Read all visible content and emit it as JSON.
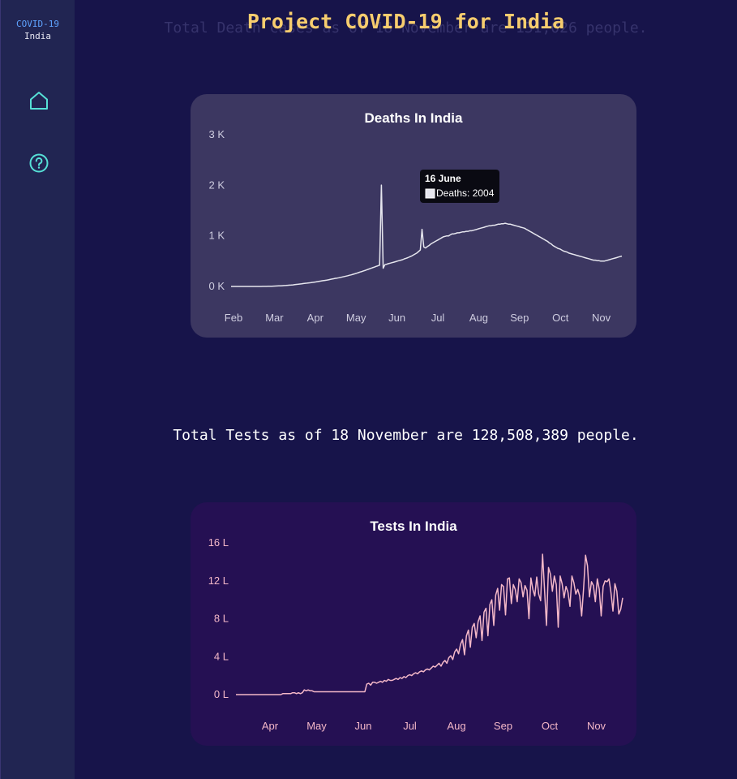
{
  "sidebar": {
    "brand_line1": "COVID-19",
    "brand_line2": "India",
    "items": [
      {
        "icon": "home-icon"
      },
      {
        "icon": "help-icon"
      }
    ],
    "icon_color": "#56e0d6"
  },
  "header": {
    "title": "Project COVID-19 for India",
    "background_text": "Total Death cases as of 18 November are 131,026 people."
  },
  "tests_summary": "Total Tests as of 18 November are 128,508,389 people.",
  "chart_data": [
    {
      "type": "line",
      "title": "Deaths In India",
      "x_tick_labels": [
        "Feb",
        "Mar",
        "Apr",
        "May",
        "Jun",
        "Jul",
        "Aug",
        "Sep",
        "Oct",
        "Nov"
      ],
      "y_tick_labels": [
        "0 K",
        "1 K",
        "2 K",
        "3 K"
      ],
      "ylim": [
        0,
        3000
      ],
      "series": [
        {
          "name": "Deaths",
          "color": "#e6e6ee",
          "values": [
            0,
            0,
            0,
            0,
            0,
            0,
            0,
            0,
            0,
            0,
            0,
            0,
            0,
            0,
            0,
            0,
            0,
            0,
            1,
            2,
            2,
            3,
            4,
            5,
            6,
            8,
            9,
            11,
            12,
            14,
            17,
            19,
            22,
            25,
            28,
            30,
            36,
            40,
            44,
            48,
            52,
            58,
            62,
            66,
            70,
            74,
            80,
            85,
            90,
            96,
            102,
            108,
            114,
            118,
            124,
            130,
            138,
            146,
            152,
            160,
            166,
            172,
            180,
            188,
            195,
            204,
            212,
            222,
            230,
            240,
            250,
            262,
            272,
            285,
            295,
            308,
            320,
            332,
            345,
            358,
            370,
            382,
            396,
            408,
            420,
            2004,
            360,
            430,
            440,
            450,
            460,
            470,
            480,
            490,
            500,
            510,
            520,
            530,
            545,
            556,
            570,
            585,
            600,
            620,
            640,
            660,
            690,
            720,
            1130,
            780,
            760,
            790,
            810,
            840,
            860,
            880,
            900,
            920,
            940,
            960,
            980,
            990,
            1000,
            1000,
            1020,
            1040,
            1040,
            1050,
            1060,
            1060,
            1070,
            1080,
            1080,
            1090,
            1090,
            1100,
            1100,
            1110,
            1120,
            1130,
            1140,
            1150,
            1160,
            1170,
            1180,
            1190,
            1200,
            1200,
            1210,
            1210,
            1220,
            1230,
            1230,
            1240,
            1240,
            1250,
            1240,
            1230,
            1230,
            1220,
            1210,
            1200,
            1190,
            1180,
            1170,
            1160,
            1150,
            1130,
            1110,
            1090,
            1070,
            1050,
            1030,
            1010,
            990,
            970,
            950,
            930,
            910,
            890,
            860,
            840,
            810,
            790,
            770,
            750,
            740,
            720,
            700,
            690,
            680,
            660,
            650,
            640,
            630,
            620,
            610,
            600,
            590,
            580,
            570,
            560,
            550,
            540,
            530,
            520,
            520,
            510,
            510,
            500,
            500,
            500,
            510,
            520,
            530,
            540,
            550,
            560,
            570,
            580,
            590,
            600
          ]
        },
        {
          "name": "tooltip"
        }
      ],
      "x_range_dates": [
        "2020-01-30",
        "2020-11-18"
      ],
      "tooltip": {
        "title": "16 June",
        "label": "Deaths",
        "value": 2004,
        "text": "Deaths: 2004"
      }
    },
    {
      "type": "line",
      "title": "Tests In India",
      "x_tick_labels": [
        "Apr",
        "May",
        "Jun",
        "Jul",
        "Aug",
        "Sep",
        "Oct",
        "Nov"
      ],
      "y_tick_labels": [
        "0 L",
        "4 L",
        "8 L",
        "12 L",
        "16 L"
      ],
      "ylim": [
        0,
        16
      ],
      "y_unit": "lakh",
      "series": [
        {
          "name": "Tests",
          "color": "#f4b8c8",
          "values": [
            0,
            0,
            0,
            0,
            0,
            0,
            0,
            0,
            0,
            0,
            0,
            0,
            0,
            0,
            0,
            0,
            0,
            0,
            0,
            0,
            0,
            0,
            0,
            0,
            0.1,
            0.1,
            0.1,
            0.1,
            0.1,
            0.2,
            0.2,
            0.1,
            0.2,
            0.1,
            0.2,
            0.5,
            0.4,
            0.5,
            0.4,
            0.4,
            0.3,
            0.3,
            0.3,
            0.3,
            0.3,
            0.3,
            0.3,
            0.3,
            0.3,
            0.3,
            0.3,
            0.3,
            0.3,
            0.3,
            0.3,
            0.3,
            0.3,
            0.3,
            0.3,
            0.3,
            0.3,
            0.3,
            0.3,
            0.3,
            0.3,
            0.3,
            0.3,
            1.1,
            1.2,
            1.0,
            1.3,
            1.3,
            1.2,
            1.3,
            1.4,
            1.3,
            1.5,
            1.4,
            1.6,
            1.5,
            1.5,
            1.6,
            1.7,
            1.6,
            1.8,
            1.7,
            1.9,
            1.8,
            2.0,
            2.1,
            2.0,
            2.2,
            2.3,
            2.2,
            2.4,
            2.5,
            2.4,
            2.6,
            2.7,
            2.6,
            2.8,
            3.0,
            2.9,
            3.1,
            3.3,
            3.0,
            3.4,
            3.6,
            3.3,
            3.9,
            4.1,
            3.7,
            4.5,
            4.8,
            4.3,
            5.3,
            5.8,
            4.2,
            6.2,
            6.8,
            5.0,
            7.1,
            7.5,
            6.0,
            7.7,
            8.3,
            5.7,
            8.7,
            9.1,
            6.2,
            9.5,
            10.0,
            7.3,
            10.5,
            11.2,
            8.9,
            11.6,
            11.4,
            8.4,
            12.2,
            12.3,
            9.6,
            11.6,
            11.1,
            9.8,
            12.2,
            11.8,
            10.3,
            11.5,
            11.0,
            8.0,
            12.3,
            11.1,
            10.4,
            12.4,
            10.6,
            9.9,
            14.8,
            11.1,
            7.3,
            13.4,
            12.7,
            10.9,
            12.5,
            11.6,
            7.1,
            12.5,
            11.7,
            10.2,
            11.4,
            10.8,
            9.3,
            12.5,
            11.8,
            10.6,
            11.1,
            10.4,
            8.3,
            11.2,
            14.7,
            13.6,
            10.3,
            11.9,
            11.5,
            9.8,
            12.2,
            11.1,
            8.3,
            11.4,
            12.0,
            11.9,
            12.2,
            10.8,
            8.8,
            11.7,
            10.9,
            8.5,
            9.0,
            10.2
          ]
        }
      ]
    }
  ]
}
